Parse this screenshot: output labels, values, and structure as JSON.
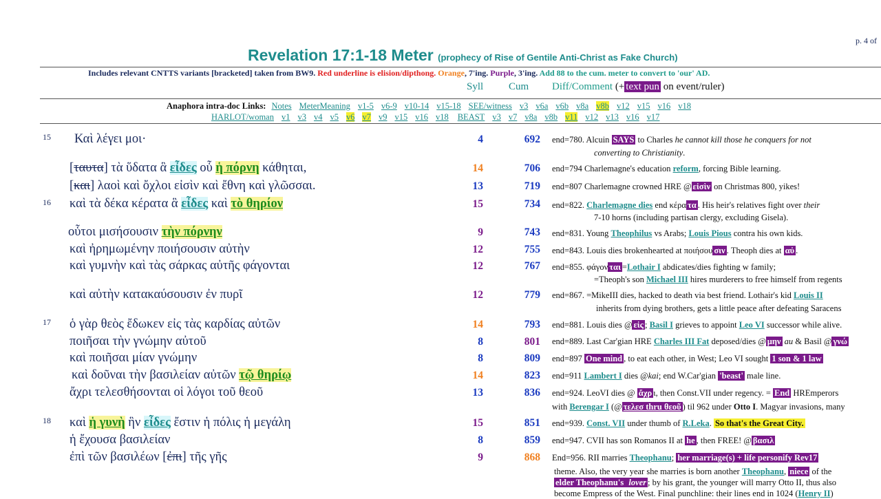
{
  "page_no": "p. 4 of",
  "title": "Revelation 17:1-18 Meter",
  "subtitle": "(prophecy of Rise of Gentile Anti-Christ as Fake Church)",
  "info": {
    "a": "Includes relevant CNTTS variants [bracketed] taken from BW9.",
    "b": "Red underline is elision/dipthong.",
    "c": "Orange",
    "d": ", 7'ing.",
    "e": "Purple",
    "f": ", 3'ing.",
    "g": "Add 88 to the cum. meter to convert to 'our' AD."
  },
  "columns": {
    "syll": "Syll",
    "cum": "Cum",
    "diff": "Diff/Comment",
    "pun_pre": "(+",
    "pun": "text pun",
    "pun_post": "on event/ruler)"
  },
  "anaphora": {
    "label": "Anaphora intra-doc Links:",
    "links": [
      "Notes",
      "MeterMeaning",
      "v1-5",
      "v6-9",
      "v10-14",
      "v15-18",
      "SEE/witness",
      "v3",
      "v6a",
      "v6b",
      "v8a",
      "v8b",
      "v12",
      "v15",
      "v16",
      "v18"
    ],
    "harlot": [
      "HARLOT/woman",
      "v1",
      "v3",
      "v4",
      "v5",
      "v6",
      "v7",
      "v9",
      "v15",
      "v16",
      "v18",
      "BEAST",
      "v3",
      "v7",
      "v8a",
      "v8b",
      "v11",
      "v12",
      "v13",
      "v16",
      "v17"
    ]
  },
  "verse_nums": [
    "15",
    "16",
    "17",
    "18"
  ],
  "lines": [
    {
      "greek": "Καὶ λέγει μοι·",
      "syll": "4",
      "cum": "692"
    },
    {
      "g1": "[",
      "gs": "ταυτα",
      "g2": "] τὰ ὕδατα ἃ ",
      "h1": "εἶδες",
      "g3": " οὗ ",
      "h2": "ἡ πόρνη",
      "g4": " κάθηται,",
      "syll": "14",
      "cum": "706"
    },
    {
      "g1": "[",
      "gs": "και",
      "g2": "] λαοὶ καὶ ὄχλοι εἰσὶν καὶ ἔθνη καὶ γλῶσσαι.",
      "syll": "13",
      "cum": "719"
    },
    {
      "g1": "καὶ τὰ δέκα κέρατα ἃ ",
      "h1": "εἶδες",
      "g2": " καὶ ",
      "h2": "τὸ θηρίον",
      "syll": "15",
      "cum": "734"
    },
    {
      "g1": "οὗτοι μισήσουσιν ",
      "h2": "τὴν πόρνην",
      "syll": "9",
      "cum": "743"
    },
    {
      "greek": "καὶ ἠρημωμένην ποιήσουσιν αὐτὴν",
      "syll": "12",
      "cum": "755"
    },
    {
      "greek": "καὶ γυμνὴν καὶ τὰς σάρκας αὐτῆς φάγονται",
      "syll": "12",
      "cum": "767"
    },
    {
      "greek": "καὶ αὐτὴν κατακαύσουσιν ἐν πυρῖ",
      "syll": "12",
      "cum": "779"
    },
    {
      "greek": "ὁ γὰρ θεὸς ἔδωκεν εἰς τὰς καρδίας αὐτῶν",
      "syll": "14",
      "cum": "793"
    },
    {
      "greek": "ποιῆσαι τὴν γνώμην αὐτοῦ",
      "syll": "8",
      "cum": "801"
    },
    {
      "greek": "καὶ ποιῆσαι μίαν γνώμην",
      "syll": "8",
      "cum": "809"
    },
    {
      "g1": "καὶ δοῦναι τὴν βασιλείαν αὐτῶν ",
      "h2": "τῷ θηρίῳ",
      "syll": "14",
      "cum": "823"
    },
    {
      "greek": "ἄχρι τελεσθήσονται οἱ λόγοι τοῦ θεοῦ",
      "syll": "13",
      "cum": "836"
    },
    {
      "g1": "καὶ ",
      "h2": "ἡ γυνὴ",
      "g2": " ἣν ",
      "h1": "εἶδες",
      "g3": " ἔστιν ἡ πόλις ἡ μεγάλη",
      "syll": "15",
      "cum": "851"
    },
    {
      "greek": "ἡ ἔχουσα βασιλείαν",
      "syll": "8",
      "cum": "859"
    },
    {
      "g1": "ἐπὶ τῶν βασιλέων [",
      "gs": "ἐπι",
      "g2": "] τῆς γῆς",
      "syll": "9",
      "cum": "868"
    }
  ],
  "comments": {
    "c0a": "end=780.  Alcuin ",
    "c0b": "SAYS",
    "c0c": " to Charles ",
    "c0d": "he cannot kill those he conquers for not",
    "c0e": "converting to Christianity",
    "c1a": "end=794  Charlemagne's education ",
    "c1b": "reform",
    "c1c": ", forcing Bible learning.",
    "c2a": "end=807  Charlemagne crowned HRE @",
    "c2b": "εἰσὶν",
    "c2c": " on Christmas 800, yikes!",
    "c3a": "end=822.  ",
    "c3b": "Charlemagne dies",
    "c3c": " end κέρα",
    "c3d": "τα",
    "c3e": ".  His heir's relatives fight over ",
    "c3f": "their",
    "c3g": "7-10 horns (including partisan clergy, excluding Gisela).",
    "c4a": "end=831.  Young ",
    "c4b": "Theophilus",
    "c4c": " vs Arabs; ",
    "c4d": "Louis Pious",
    "c4e": " contra his own kids.",
    "c5a": "end=843.   Louis dies brokenhearted at ποιήσου",
    "c5b": "σιν",
    "c5c": ". Theoph dies at ",
    "c5d": "αὐ",
    "c5e": ".",
    "c6a": "end=855.  φάγον",
    "c6b": "ται",
    "c6c": "=",
    "c6d": "Lothair I",
    "c6e": " abdicates/dies fighting w family;",
    "c6f": "=Theoph's son ",
    "c6g": "Michael III",
    "c6h": " hires murderers to free himself from regents",
    "c7a": "end=867.   =MikeIII dies, hacked to death via best friend.  Lothair's kid ",
    "c7b": "Louis II",
    "c7c": "inherits from dying brothers, gets a little peace after defeating Saracens",
    "c8a": "end=881. Louis dies @",
    "c8b": "εἰς",
    "c8c": "; ",
    "c8d": "Basil I",
    "c8e": " grieves to appoint ",
    "c8f": "Leo VI",
    "c8g": " successor while alive.",
    "c9a": "end=889.  Last Car'gian HRE ",
    "c9b": "Charles III Fat",
    "c9c": " deposed/dies @",
    "c9d": "μην",
    "c9e": " au",
    "c9f": " & Basil @",
    "c9g": "γνώ",
    "c10a": "end=897  ",
    "c10b": "One mind",
    "c10c": ", to eat each other, in West; Leo VI sought ",
    "c10d": "1 son & 1 law",
    "c11a": "end=911 ",
    "c11b": "Lambert I",
    "c11c": " dies @",
    "c11d": "kai",
    "c11e": "; end W.Car'gian ",
    "c11f": "'beast'",
    "c11g": " male line.",
    "c12a": "end=924. LeoVI dies @ ",
    "c12b": "ἄχρ",
    "c12c": "ι, then Const.VII under regency. = ",
    "c12d": "End",
    "c12e": " HREmperors",
    "c12f": "with ",
    "c12g": "Berengar I",
    "c12h": " (@",
    "c12i": "τελεσ thru θεοῦ",
    "c12j": ")  til 962 under ",
    "c12k": "Otto I",
    "c12l": ". Magyar invasions, many",
    "c13a": "end=939. ",
    "c13b": "Const. VII",
    "c13c": " under thumb of ",
    "c13d": "R.Leka",
    "c13e": ".  ",
    "c13f": "So that's the Great City.",
    "c14a": "end=947.  CVII has son Romanos II at ",
    "c14b": "he",
    "c14c": ", then FREE! @",
    "c14d": "βασιλ",
    "c15a": "End=956.  RII marries ",
    "c15b": "Theophanu",
    "c15c": "; ",
    "c15d": "her marriage(s) + life personify Rev17",
    "c15e": "theme.  Also, the very year she marries is born another ",
    "c15f": "Theophanu",
    "c15g": ", ",
    "c15h": "niece",
    "c15i": " of the",
    "c15j": "elder Theophanu's ",
    "c15k": "lover",
    "c15l": "; by his grant, the younger will marry Otto II, thus also",
    "c15m": "become Empress of the West. Final punchline: their lines end in 1024 (",
    "c15n": "Henry II",
    "c15o": ")"
  },
  "colors": {
    "teal": "#1e8c8c",
    "purple": "#7a1a8a",
    "orange": "#f08020",
    "blue": "#1a3ac0",
    "yellow": "#f5ee30"
  }
}
